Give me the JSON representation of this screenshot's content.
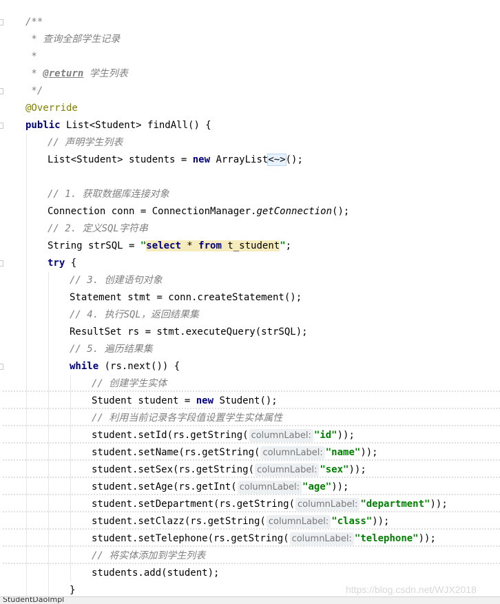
{
  "editor": {
    "lines": {
      "l01": "/**",
      "l02": " * 查询全部学生记录",
      "l03": " *",
      "l04a": " * ",
      "l04b": "@return",
      "l04c": " 学生列表",
      "l05": " */",
      "l06": "@Override",
      "l07a": "public",
      "l07b": " List<Student> findAll() {",
      "l08": "// 声明学生列表",
      "l09a": "List<Student> students = ",
      "l09b": "new",
      "l09c": " ArrayList",
      "l09d": "<~>",
      "l09e": "();",
      "l11": "// 1. 获取数据库连接对象",
      "l12a": "Connection conn = ConnectionManager.",
      "l12b": "getConnection",
      "l12c": "();",
      "l13": "// 2. 定义SQL字符串",
      "l14a": "String strSQL = ",
      "l14b": "\"",
      "l14c": "select",
      "l14d": " * ",
      "l14e": "from",
      "l14f": " t_student",
      "l14g": "\"",
      "l14h": ";",
      "l15a": "try",
      "l15b": " {",
      "l16": "// 3. 创建语句对象",
      "l17": "Statement stmt = conn.createStatement();",
      "l18": "// 4. 执行SQL，返回结果集",
      "l19": "ResultSet rs = stmt.executeQuery(strSQL);",
      "l20": "// 5. 遍历结果集",
      "l21a": "while",
      "l21b": " (rs.next()) {",
      "l22": "// 创建学生实体",
      "l23a": "Student student = ",
      "l23b": "new",
      "l23c": " Student();",
      "l24": "// 利用当前记录各字段值设置学生实体属性",
      "l25a": "student.setId(rs.getString(",
      "l25s": "\"id\"",
      "l25c": "));",
      "l26a": "student.setName(rs.getString(",
      "l26s": "\"name\"",
      "l26c": "));",
      "l27a": "student.setSex(rs.getString(",
      "l27s": "\"sex\"",
      "l27c": "));",
      "l28a": "student.setAge(rs.getInt(",
      "l28s": "\"age\"",
      "l28c": "));",
      "l29a": "student.setDepartment(rs.getString(",
      "l29s": "\"department\"",
      "l29c": "));",
      "l30a": "student.setClazz(rs.getString(",
      "l30s": "\"class\"",
      "l30c": "));",
      "l31a": "student.setTelephone(rs.getString(",
      "l31s": "\"telephone\"",
      "l31c": "));",
      "l32": "// 将实体添加到学生列表",
      "l33": "students.add(student);",
      "l34": "}"
    },
    "hint_label": "columnLabel:"
  },
  "tab": {
    "label": "StudentDaoImpl"
  },
  "watermark": "https://blog.csdn.net/WJX2018",
  "colors": {
    "keyword": "#000080",
    "string": "#008000",
    "comment": "#808080",
    "annotation": "#808000",
    "highlight": "#f6ebbc"
  }
}
